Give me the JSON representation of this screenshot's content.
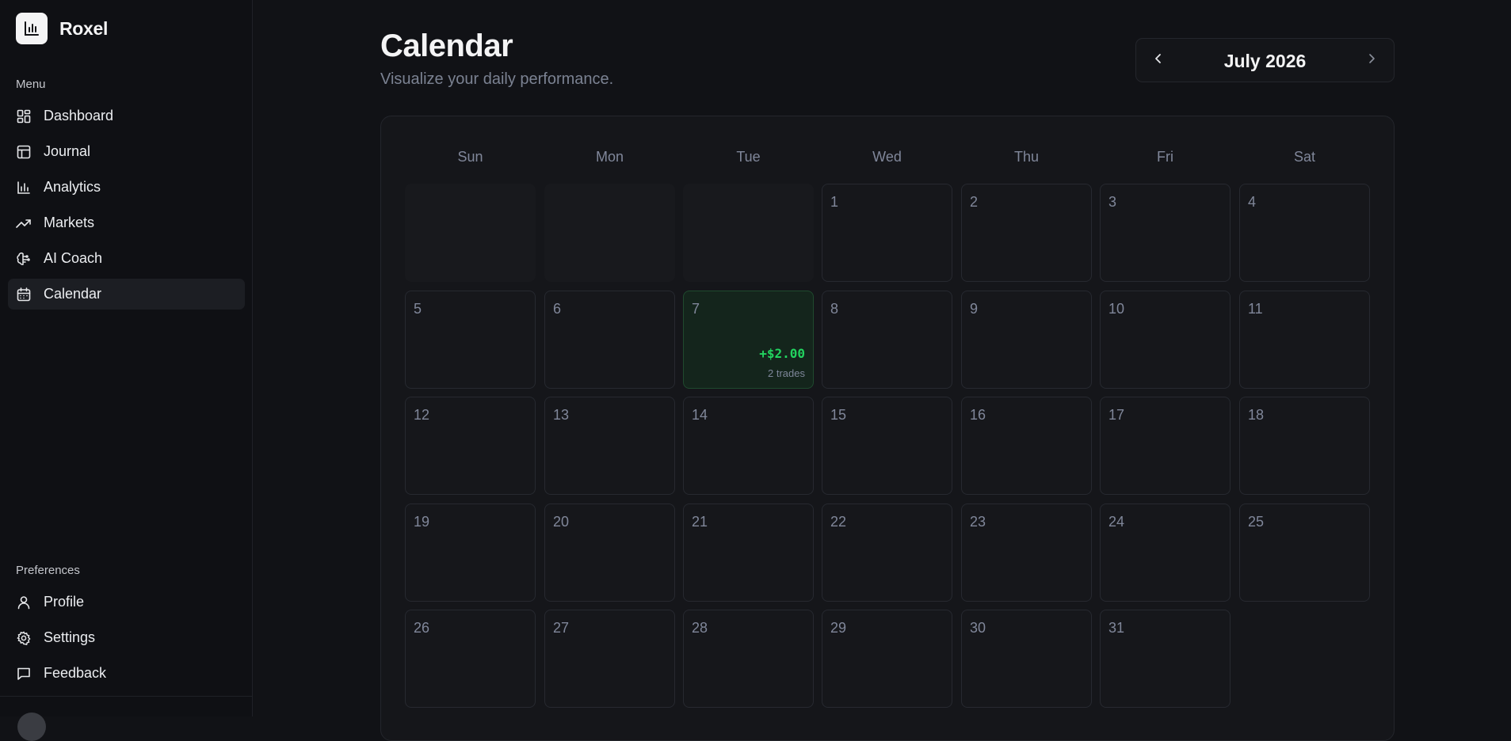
{
  "brand": {
    "name": "Roxel"
  },
  "sidebar": {
    "menu_label": "Menu",
    "items": [
      {
        "label": "Dashboard",
        "icon": "dashboard-icon",
        "active": false
      },
      {
        "label": "Journal",
        "icon": "table-icon",
        "active": false
      },
      {
        "label": "Analytics",
        "icon": "bar-chart-icon",
        "active": false
      },
      {
        "label": "Markets",
        "icon": "trending-up-icon",
        "active": false
      },
      {
        "label": "AI Coach",
        "icon": "brain-icon",
        "active": false
      },
      {
        "label": "Calendar",
        "icon": "calendar-icon",
        "active": true
      }
    ],
    "preferences_label": "Preferences",
    "pref_items": [
      {
        "label": "Profile",
        "icon": "user-icon"
      },
      {
        "label": "Settings",
        "icon": "gear-icon"
      },
      {
        "label": "Feedback",
        "icon": "message-icon"
      }
    ]
  },
  "header": {
    "title": "Calendar",
    "subtitle": "Visualize your daily performance."
  },
  "month_nav": {
    "label": "July 2026",
    "prev_icon": "chevron-left-icon",
    "next_icon": "chevron-right-icon"
  },
  "calendar": {
    "weekdays": [
      "Sun",
      "Mon",
      "Tue",
      "Wed",
      "Thu",
      "Fri",
      "Sat"
    ],
    "leading_blanks": 3,
    "days_in_month": 31,
    "entries": [
      {
        "day": 7,
        "pnl": "+$2.00",
        "trades": "2 trades",
        "status": "profit"
      }
    ]
  },
  "colors": {
    "background": "#111216",
    "profit_text": "#22d35f",
    "profit_bg": "#14251c",
    "muted_text": "#80879a"
  }
}
